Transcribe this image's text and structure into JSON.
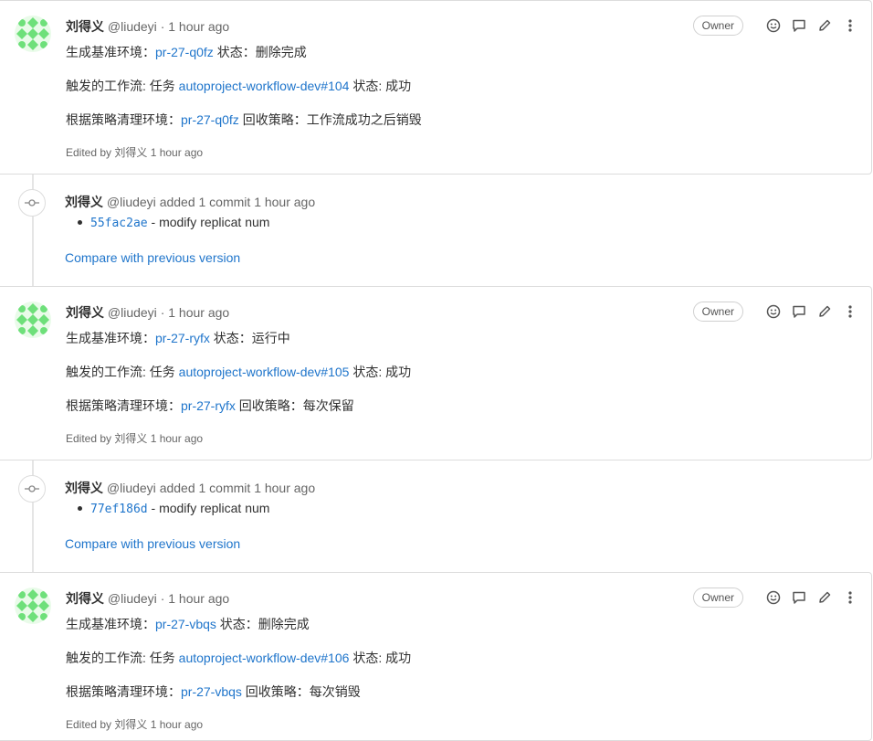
{
  "notes": [
    {
      "author_name": "刘得义",
      "author_handle": "@liudeyi",
      "separator": "·",
      "time": "1 hour ago",
      "badge": "Owner",
      "line1_prefix": "生成基准环境：",
      "line1_link": "pr-27-q0fz",
      "line1_suffix": " 状态：删除完成",
      "line2_prefix": "触发的工作流: 任务 ",
      "line2_link": "autoproject-workflow-dev#104",
      "line2_suffix": " 状态: 成功",
      "line3_prefix": "根据策略清理环境：",
      "line3_link": "pr-27-q0fz",
      "line3_suffix": " 回收策略：工作流成功之后销毁",
      "edited": "Edited by 刘得义 1 hour ago"
    },
    {
      "author_name": "刘得义",
      "author_handle": "@liudeyi",
      "separator": "·",
      "time": "1 hour ago",
      "badge": "Owner",
      "line1_prefix": "生成基准环境：",
      "line1_link": "pr-27-ryfx",
      "line1_suffix": " 状态：运行中",
      "line2_prefix": "触发的工作流: 任务 ",
      "line2_link": "autoproject-workflow-dev#105",
      "line2_suffix": " 状态: 成功",
      "line3_prefix": "根据策略清理环境：",
      "line3_link": "pr-27-ryfx",
      "line3_suffix": " 回收策略：每次保留",
      "edited": "Edited by 刘得义 1 hour ago"
    },
    {
      "author_name": "刘得义",
      "author_handle": "@liudeyi",
      "separator": "·",
      "time": "1 hour ago",
      "badge": "Owner",
      "line1_prefix": "生成基准环境：",
      "line1_link": "pr-27-vbqs",
      "line1_suffix": " 状态：删除完成",
      "line2_prefix": "触发的工作流: 任务 ",
      "line2_link": "autoproject-workflow-dev#106",
      "line2_suffix": " 状态: 成功",
      "line3_prefix": "根据策略清理环境：",
      "line3_link": "pr-27-vbqs",
      "line3_suffix": " 回收策略：每次销毁",
      "edited": "Edited by 刘得义 1 hour ago"
    }
  ],
  "system_notes": [
    {
      "author_name": "刘得义",
      "author_handle": "@liudeyi",
      "action": "added 1 commit",
      "time": "1 hour ago",
      "commit_sha": "55fac2ae",
      "commit_message": " - modify replicat num",
      "compare_label": "Compare with previous version"
    },
    {
      "author_name": "刘得义",
      "author_handle": "@liudeyi",
      "action": "added 1 commit",
      "time": "1 hour ago",
      "commit_sha": "77ef186d",
      "commit_message": " - modify replicat num",
      "compare_label": "Compare with previous version"
    }
  ],
  "colors": {
    "link": "#1f75cb",
    "avatar_green": "#6ee07a"
  },
  "icons": [
    "smiley-icon",
    "comment-icon",
    "pencil-icon",
    "kebab-icon",
    "commit-icon"
  ]
}
